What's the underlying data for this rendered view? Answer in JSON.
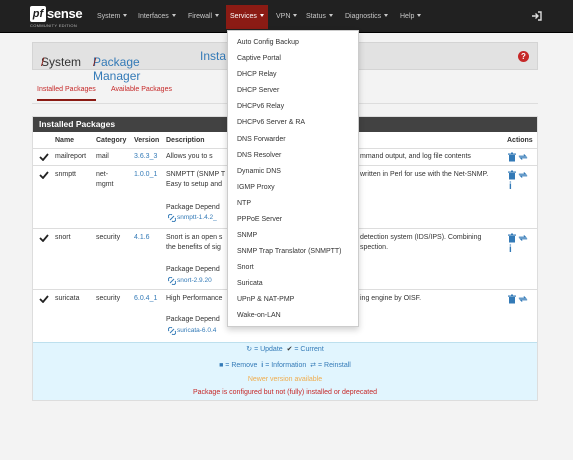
{
  "navbar": {
    "logo_text": "sense",
    "logo_pf": "pf",
    "logo_edition": "COMMUNITY EDITION",
    "items": [
      "System",
      "Interfaces",
      "Firewall",
      "Services",
      "VPN",
      "Status",
      "Diagnostics",
      "Help"
    ],
    "active": "Services"
  },
  "breadcrumb": {
    "system": "System",
    "package_manager": "Package Manager",
    "installed": "Insta",
    "sep": "/"
  },
  "tabs": {
    "installed": "Installed Packages",
    "available": "Available Packages"
  },
  "panel": {
    "heading": "Installed Packages",
    "columns": {
      "name": "Name",
      "category": "Category",
      "version": "Version",
      "description": "Description",
      "actions": "Actions"
    }
  },
  "packages": [
    {
      "name": "mailreport",
      "category": "mail",
      "version": "3.6.3_3",
      "desc_start": "Allows you to s",
      "desc_end": "mmand output, and log file contents",
      "dep_label": "",
      "dep": ""
    },
    {
      "name": "snmptt",
      "category": "net-mgmt",
      "version": "1.0.0_1",
      "desc_start": "SNMPTT (SNMP T",
      "desc_line2": "Easy to setup and",
      "desc_end": "written in Perl for use with the Net-SNMP.",
      "dep_label": "Package Depend",
      "dep": "snmptt-1.4.2_"
    },
    {
      "name": "snort",
      "category": "security",
      "version": "4.1.6",
      "desc_start": "Snort is an open s",
      "desc_line2": "the benefits of sig",
      "desc_end": "detection system (IDS/IPS). Combining",
      "desc_end2": "spection.",
      "dep_label": "Package Depend",
      "dep": "snort-2.9.20"
    },
    {
      "name": "suricata",
      "category": "security",
      "version": "6.0.4_1",
      "desc_start": "High Performance",
      "desc_end": "ing engine by OISF.",
      "dep_label": "Package Depend",
      "dep": "suricata-6.0.4"
    }
  ],
  "legend": {
    "update": "= Update",
    "current": "= Current",
    "remove": "= Remove",
    "information": "= Information",
    "reinstall": "= Reinstall",
    "newer": "Newer version available",
    "partial": "Package is configured but not (fully) installed or deprecated"
  },
  "services_menu": [
    "Auto Config Backup",
    "Captive Portal",
    "DHCP Relay",
    "DHCP Server",
    "DHCPv6 Relay",
    "DHCPv6 Server & RA",
    "DNS Forwarder",
    "DNS Resolver",
    "Dynamic DNS",
    "IGMP Proxy",
    "NTP",
    "PPPoE Server",
    "SNMP",
    "SNMP Trap Translator (SNMPTT)",
    "Snort",
    "Suricata",
    "UPnP & NAT-PMP",
    "Wake-on-LAN"
  ],
  "colors": {
    "navbar": "#212121",
    "active": "#8b1b14",
    "link": "#337ab7",
    "danger": "#c62828",
    "warning": "#f0ad4e",
    "legend_bg": "#e1f5fe"
  }
}
